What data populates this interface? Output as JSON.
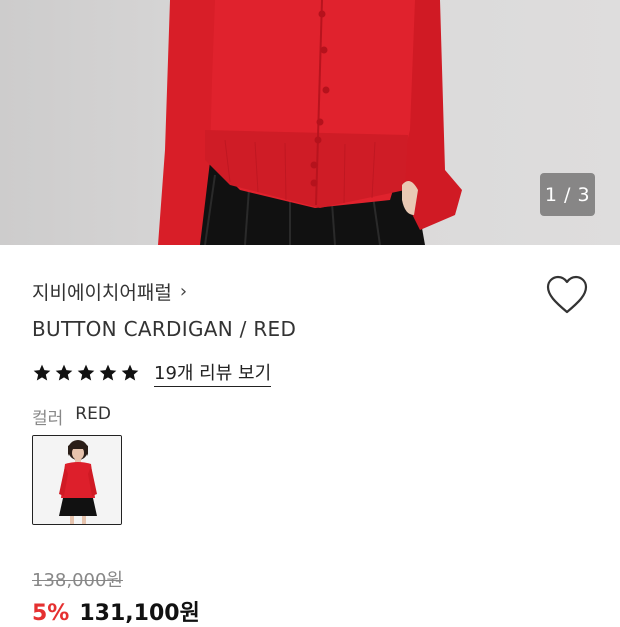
{
  "gallery": {
    "counter": "1 / 3",
    "accent": "#de1e2a"
  },
  "product": {
    "brand": "지비에이치어패럴",
    "brand_chevron": "›",
    "name": "BUTTON CARDIGAN / RED",
    "rating_stars": 5,
    "review_link": "19개 리뷰 보기",
    "color_label": "컬러",
    "color_value": "RED",
    "original_price": "138,000원",
    "discount": "5%",
    "final_price": "131,100원"
  },
  "icons": {
    "wishlist": "heart-outline-icon",
    "star": "star-icon"
  }
}
